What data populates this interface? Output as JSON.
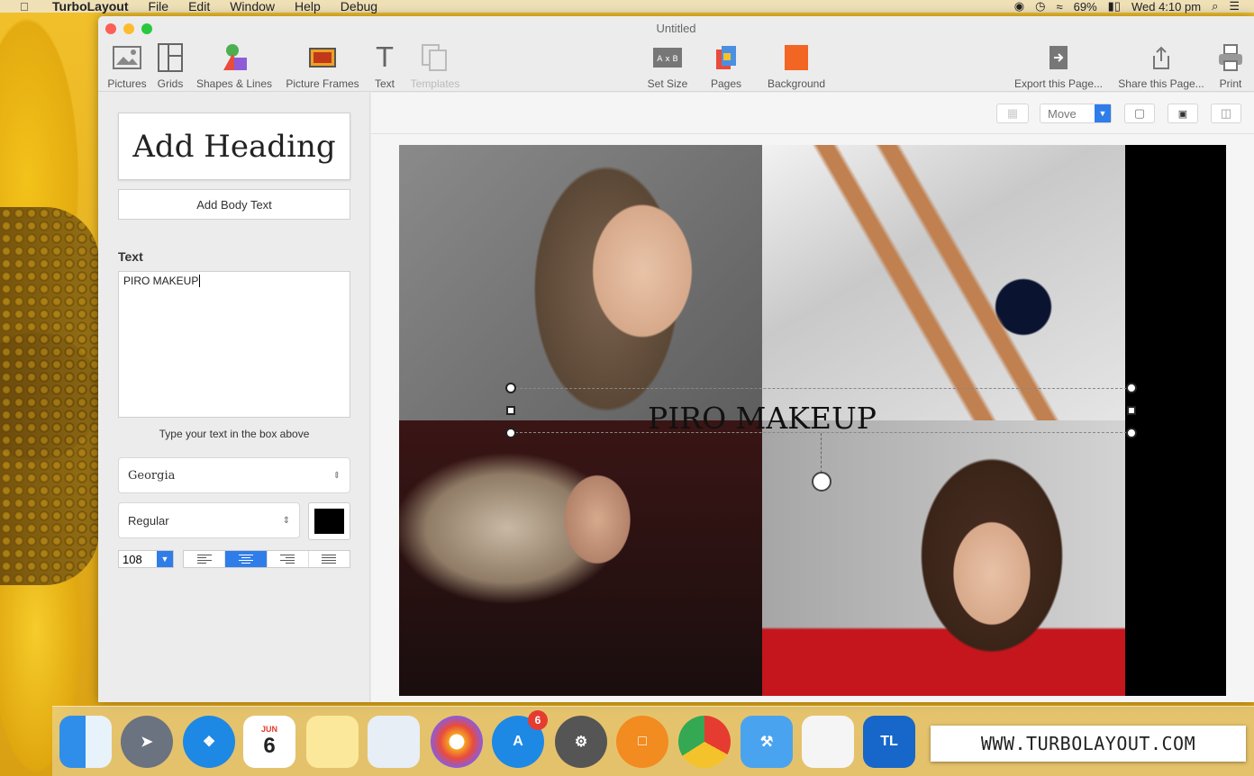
{
  "menubar": {
    "app_name": "TurboLayout",
    "menus": [
      "File",
      "Edit",
      "Window",
      "Help",
      "Debug"
    ],
    "battery": "69%",
    "clock": "Wed 4:10 pm"
  },
  "window": {
    "title": "Untitled"
  },
  "toolbar": {
    "pictures": "Pictures",
    "grids": "Grids",
    "shapes": "Shapes & Lines",
    "frames": "Picture Frames",
    "text": "Text",
    "templates": "Templates",
    "set_size": "Set Size",
    "pages": "Pages",
    "background": "Background",
    "export": "Export this Page...",
    "share": "Share this Page...",
    "print": "Print"
  },
  "left_panel": {
    "add_heading": "Add Heading",
    "add_body": "Add Body Text",
    "text_label": "Text",
    "text_value": "PIRO MAKEUP",
    "hint": "Type your text in the box above",
    "font": "Georgia",
    "style": "Regular",
    "size": "108",
    "text_color": "#000000",
    "alignment": "center"
  },
  "canvas": {
    "move_mode": "Move",
    "page_text": "PIRO MAKEUP"
  },
  "dock": {
    "appstore_badge": "6",
    "calendar_month": "JUN",
    "calendar_day": "6",
    "tl_label": "TL",
    "banner": "WWW.TURBOLAYOUT.COM"
  },
  "colors": {
    "accent": "#2f7de9",
    "background_swatch": "#f26522"
  }
}
